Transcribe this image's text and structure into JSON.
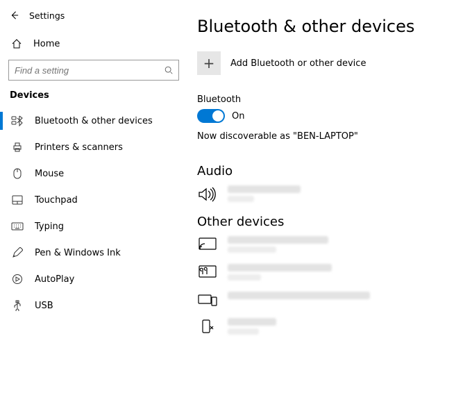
{
  "header": {
    "app_title": "Settings"
  },
  "home": {
    "label": "Home"
  },
  "search": {
    "placeholder": "Find a setting"
  },
  "category": {
    "label": "Devices"
  },
  "nav": [
    {
      "label": "Bluetooth & other devices",
      "active": true
    },
    {
      "label": "Printers & scanners"
    },
    {
      "label": "Mouse"
    },
    {
      "label": "Touchpad"
    },
    {
      "label": "Typing"
    },
    {
      "label": "Pen & Windows Ink"
    },
    {
      "label": "AutoPlay"
    },
    {
      "label": "USB"
    }
  ],
  "page": {
    "title": "Bluetooth & other devices",
    "add_label": "Add Bluetooth or other device",
    "bt_label": "Bluetooth",
    "bt_state": "On",
    "discoverable": "Now discoverable as \"BEN-LAPTOP\"",
    "section_audio": "Audio",
    "section_other": "Other devices"
  }
}
